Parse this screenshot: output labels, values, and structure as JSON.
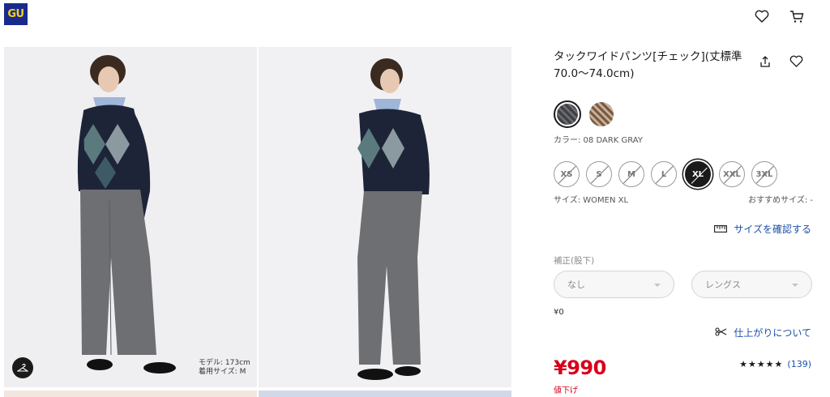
{
  "header": {
    "logo_text": "GU",
    "icons": [
      "heart-icon",
      "cart-icon"
    ]
  },
  "gallery": {
    "model_caption_line1": "モデル: 173cm",
    "model_caption_line2": "着用サイズ: M"
  },
  "product": {
    "title": "タックワイドパンツ[チェック](丈標準70.0～74.0cm)",
    "color_label": "カラー: 08 DARK GRAY",
    "colors": [
      {
        "name": "DARK GRAY",
        "hex": "#4a4c50",
        "selected": true
      },
      {
        "name": "BROWN",
        "hex": "#8a6a52",
        "selected": false
      }
    ],
    "sizes": [
      {
        "label": "XS",
        "available": false,
        "selected": false
      },
      {
        "label": "S",
        "available": false,
        "selected": false
      },
      {
        "label": "M",
        "available": false,
        "selected": false
      },
      {
        "label": "L",
        "available": false,
        "selected": false
      },
      {
        "label": "XL",
        "available": false,
        "selected": true
      },
      {
        "label": "XXL",
        "available": false,
        "selected": false
      },
      {
        "label": "3XL",
        "available": false,
        "selected": false
      }
    ],
    "size_label": "サイズ: WOMEN XL",
    "recommended_size_label": "おすすめサイズ: -",
    "size_check_link": "サイズを確認する",
    "alteration_label": "補正(股下)",
    "alteration_select_1": "なし",
    "alteration_select_2": "レングス",
    "alteration_price": "¥0",
    "finish_link": "仕上がりについて",
    "price": "¥990",
    "price_note": "値下げ",
    "rating_stars": "★★★★★",
    "rating_value": 4.5,
    "review_count": "(139)"
  },
  "colors": {
    "accent_red": "#d6001c",
    "link_blue": "#1d4fa8",
    "logo_bg": "#1a2a8c",
    "logo_fg": "#f2d21c"
  }
}
